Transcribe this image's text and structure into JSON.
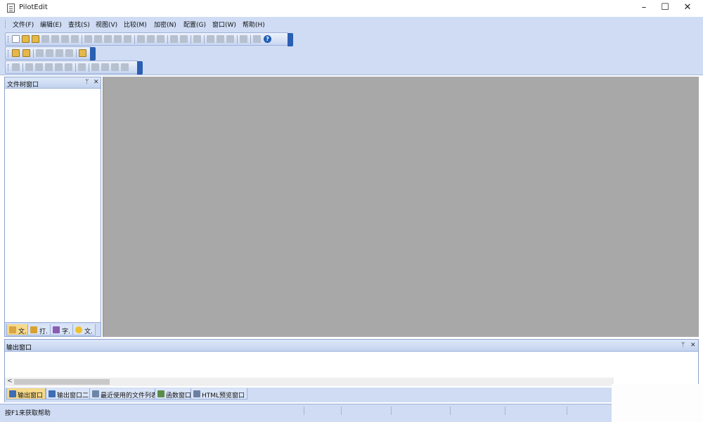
{
  "window": {
    "title": "PilotEdit",
    "minimize_glyph": "–",
    "maximize_glyph": "☐",
    "close_glyph": "✕"
  },
  "menu": [
    {
      "label": "文件(F)"
    },
    {
      "label": "编辑(E)"
    },
    {
      "label": "查找(S)"
    },
    {
      "label": "视图(V)"
    },
    {
      "label": "比较(M)"
    },
    {
      "label": "加密(N)"
    },
    {
      "label": "配置(G)"
    },
    {
      "label": "窗口(W)"
    },
    {
      "label": "帮助(H)"
    }
  ],
  "help_glyph": "?",
  "file_tree": {
    "title": "文件树窗口",
    "pin_glyph": "ᛘ",
    "close_glyph": "✕",
    "tabs": [
      {
        "label": "文.",
        "icon": "folder-tree-icon",
        "color": "#d9a441"
      },
      {
        "label": "打.",
        "icon": "open-file-icon",
        "color": "#d8a232"
      },
      {
        "label": "字.",
        "icon": "font-icon",
        "color": "#8b5db3"
      },
      {
        "label": "文.",
        "icon": "favorites-star-icon",
        "color": "#f0c02c"
      }
    ]
  },
  "output": {
    "title": "输出窗口",
    "pin_glyph": "ᛘ",
    "close_glyph": "✕",
    "scroll_left_glyph": "<",
    "tabs": [
      {
        "label": "输出窗口",
        "icon": "output-icon",
        "color": "#3d6db5"
      },
      {
        "label": "输出窗口二",
        "icon": "output-icon",
        "color": "#3d6db5"
      },
      {
        "label": "最近使用的文件列表",
        "icon": "recent-files-icon",
        "color": "#6d86a8"
      },
      {
        "label": "函数窗口",
        "icon": "function-icon",
        "color": "#5b8d4a"
      },
      {
        "label": "HTML预览窗口",
        "icon": "html-preview-icon",
        "color": "#6b7fa3"
      }
    ]
  },
  "status": {
    "text": "按F1来获取帮助"
  }
}
